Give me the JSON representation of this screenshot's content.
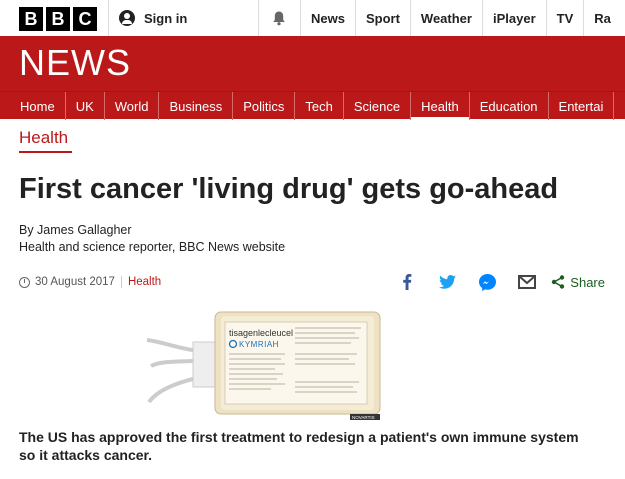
{
  "topbar": {
    "logo_letters": [
      "B",
      "B",
      "C"
    ],
    "signin_label": "Sign in",
    "nav": [
      "News",
      "Sport",
      "Weather",
      "iPlayer",
      "TV",
      "Ra"
    ]
  },
  "banner": {
    "title": "NEWS"
  },
  "section_nav": {
    "items": [
      "Home",
      "UK",
      "World",
      "Business",
      "Politics",
      "Tech",
      "Science",
      "Health",
      "Education",
      "Entertai"
    ],
    "active": "Health"
  },
  "article": {
    "section_label": "Health",
    "headline": "First cancer 'living drug' gets go-ahead",
    "author": "By James Gallagher",
    "author_role": "Health and science reporter, BBC News website",
    "date": "30 August 2017",
    "tag": "Health",
    "share_label": "Share",
    "image_text": {
      "brand_generic": "tisagenlecleucel",
      "brand_name": "KYMRIAH",
      "badge": "NOVARTIS"
    },
    "summary": "The US has approved the first treatment to redesign a patient's own immune system so it attacks cancer."
  },
  "colors": {
    "brand_red": "#bb1919",
    "facebook": "#3b5998",
    "twitter": "#1da1f2",
    "messenger": "#0084ff",
    "share_green": "#1b5e20"
  },
  "icons": [
    "user-icon",
    "bell-icon",
    "clock-icon",
    "facebook-icon",
    "twitter-icon",
    "messenger-icon",
    "email-icon",
    "share-icon"
  ]
}
